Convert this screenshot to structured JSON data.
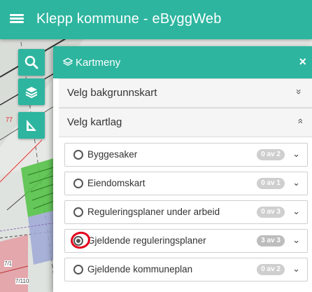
{
  "app": {
    "title": "Klepp kommune - eByggWeb"
  },
  "icons": {
    "menu": "hamburger-icon",
    "search": "search-icon",
    "layers": "layers-icon",
    "measure": "ruler-icon",
    "close": "close-icon"
  },
  "colors": {
    "accent": "#2db59f",
    "highlight_mark": "#e3001b"
  },
  "panel": {
    "title": "Kartmeny",
    "close_label": "×",
    "background_map": {
      "label": "Velg bakgrunnskart",
      "chevron": "»",
      "state": "collapsed"
    },
    "layers_section": {
      "label": "Velg kartlag",
      "chevron": "»",
      "state": "expanded"
    },
    "layers": [
      {
        "name": "Byggesaker",
        "badge": "0 av 2",
        "checked": false
      },
      {
        "name": "Eiendomskart",
        "badge": "0 av 1",
        "checked": false
      },
      {
        "name": "Reguleringsplaner under arbeid",
        "badge": "0 av 3",
        "checked": false
      },
      {
        "name": "Gjeldende reguleringsplaner",
        "badge": "3 av 3",
        "checked": true
      },
      {
        "name": "Gjeldende kommuneplan",
        "badge": "0 av 2",
        "checked": false
      }
    ]
  },
  "map": {
    "labels": [
      "77",
      "7/1",
      "7/110"
    ]
  }
}
